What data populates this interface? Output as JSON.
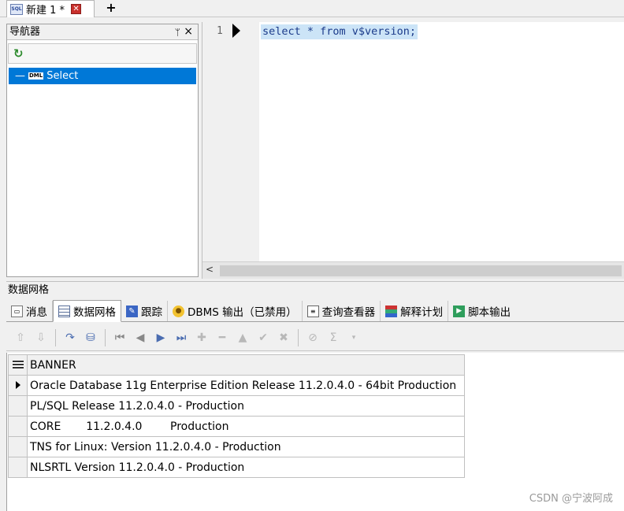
{
  "document_tab": {
    "icon": "sql-file-icon",
    "label": "新建 1 *",
    "close_glyph": "✕"
  },
  "new_tab_glyph": "+",
  "navigator": {
    "title": "导航器",
    "pin_glyph": "ᛘ",
    "close_glyph": "×",
    "items": [
      {
        "type": "DML",
        "label": "Select",
        "selected": true
      }
    ]
  },
  "editor": {
    "line_number": "1",
    "code": "select * from v$version;",
    "selection_color": "#cce4f7"
  },
  "grid_panel": {
    "title": "数据网格"
  },
  "tabs": [
    {
      "label": "消息",
      "icon": "message-icon"
    },
    {
      "label": "数据网格",
      "icon": "data-grid-icon",
      "active": true
    },
    {
      "label": "跟踪",
      "icon": "trace-icon"
    },
    {
      "label": "DBMS 输出（已禁用）",
      "icon": "dbms-output-icon"
    },
    {
      "label": "查询查看器",
      "icon": "query-viewer-icon"
    },
    {
      "label": "解释计划",
      "icon": "explain-plan-icon"
    },
    {
      "label": "脚本输出",
      "icon": "script-output-icon"
    }
  ],
  "result": {
    "columns": [
      "BANNER"
    ],
    "rows": [
      "Oracle Database 11g Enterprise Edition Release 11.2.0.4.0 - 64bit Production",
      "PL/SQL Release 11.2.0.4.0 - Production",
      "CORE\t11.2.0.4.0\tProduction",
      "TNS for Linux: Version 11.2.0.4.0 - Production",
      "NLSRTL Version 11.2.0.4.0 - Production"
    ],
    "current_row": 0
  },
  "watermark": "CSDN @宁波阿成",
  "colors": {
    "selection_blue": "#0078d7",
    "close_red": "#c9302c"
  }
}
